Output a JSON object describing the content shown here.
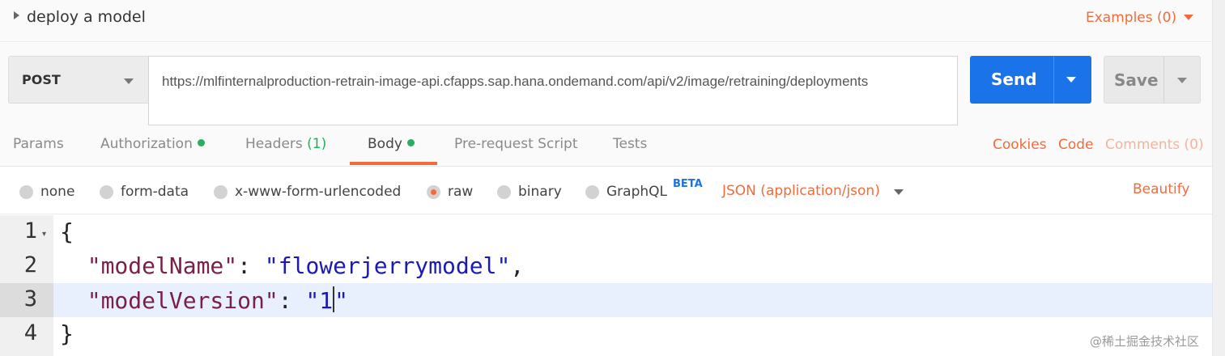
{
  "header": {
    "request_name": "deploy a model",
    "examples_label": "Examples (0)"
  },
  "request": {
    "method": "POST",
    "url": "https://mlfinternalproduction-retrain-image-api.cfapps.sap.hana.ondemand.com/api/v2/image/retraining/deployments",
    "send_label": "Send",
    "save_label": "Save"
  },
  "tabs": {
    "params": "Params",
    "authorization": "Authorization",
    "headers": "Headers",
    "headers_count": "(1)",
    "body": "Body",
    "prerequest": "Pre-request Script",
    "tests": "Tests",
    "active": "Body"
  },
  "links": {
    "cookies": "Cookies",
    "code": "Code",
    "comments": "Comments (0)"
  },
  "body_options": {
    "none": "none",
    "form_data": "form-data",
    "urlencoded": "x-www-form-urlencoded",
    "raw": "raw",
    "binary": "binary",
    "graphql": "GraphQL",
    "beta_badge": "BETA",
    "selected": "raw",
    "format": "JSON (application/json)",
    "beautify": "Beautify"
  },
  "editor": {
    "line_numbers": [
      "1",
      "2",
      "3",
      "4"
    ],
    "line1": "{",
    "key1": "\"modelName\"",
    "val1": "\"flowerjerrymodel\"",
    "key2": "\"modelVersion\"",
    "val2_a": "\"1",
    "val2_b": "\"",
    "line4": "}",
    "active_line": 3
  },
  "watermark": "@稀土掘金技术社区",
  "colors": {
    "accent": "#f26b3a",
    "send": "#1a73e8",
    "status_green": "#27ae60"
  }
}
